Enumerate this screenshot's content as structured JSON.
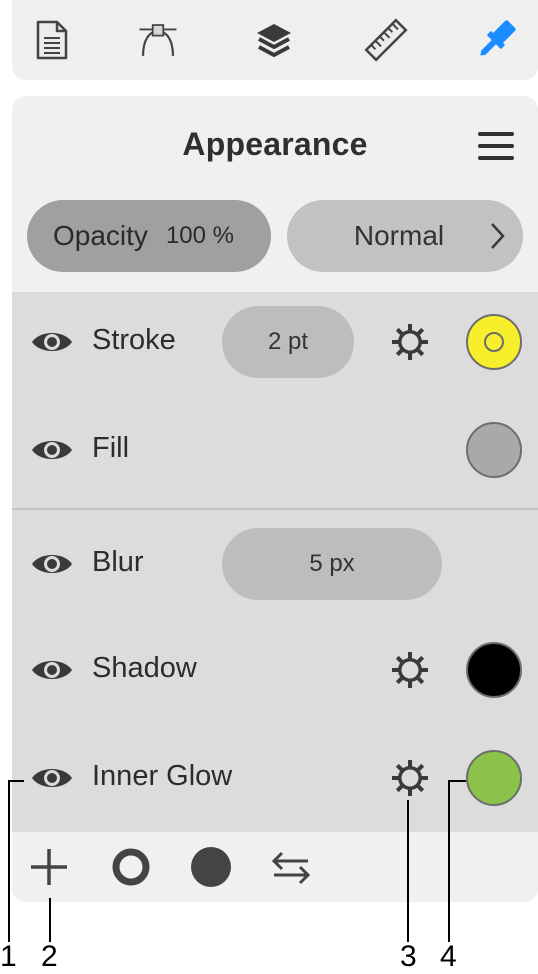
{
  "toolbar": {
    "tools": [
      {
        "name": "document-icon",
        "active": false
      },
      {
        "name": "bezier-path-icon",
        "active": false
      },
      {
        "name": "layers-icon",
        "active": false
      },
      {
        "name": "ruler-icon",
        "active": false
      },
      {
        "name": "paintbrush-icon",
        "active": true
      }
    ],
    "active_color": "#1a8cff"
  },
  "panel": {
    "title": "Appearance",
    "opacity": {
      "label": "Opacity",
      "value": "100 %"
    },
    "blend_mode": {
      "value": "Normal"
    }
  },
  "effects": {
    "stroke": {
      "label": "Stroke",
      "value": "2 pt",
      "color": "#f7ef2b"
    },
    "fill": {
      "label": "Fill",
      "color": "#a9a9a9"
    },
    "blur": {
      "label": "Blur",
      "value": "5 px"
    },
    "shadow": {
      "label": "Shadow",
      "color": "#000000"
    },
    "inner_glow": {
      "label": "Inner Glow",
      "color": "#8bc34a"
    }
  },
  "footer": {
    "buttons": [
      "add-icon",
      "ring-icon",
      "filled-circle-icon",
      "swap-arrows-icon"
    ]
  },
  "callouts": [
    "1",
    "2",
    "3",
    "4"
  ]
}
